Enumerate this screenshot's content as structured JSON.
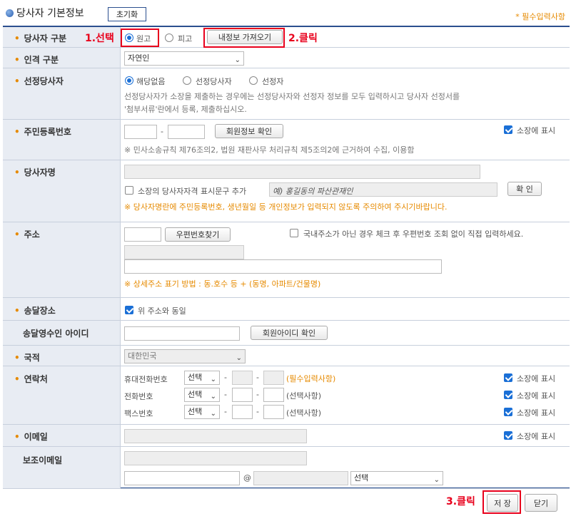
{
  "header": {
    "title": "당사자 기본정보",
    "reset_label": "초기화",
    "required_note": "* 필수입력사항"
  },
  "rows": {
    "party_type": {
      "label": "당사자 구분",
      "options": [
        "원고",
        "피고"
      ],
      "selected": "원고",
      "fetch_button": "내정보 가져오기"
    },
    "person_type": {
      "label": "인격 구분",
      "value": "자연인"
    },
    "representative": {
      "label": "선정당사자",
      "options": [
        "해당없음",
        "선정당사자",
        "선정자"
      ],
      "selected": "해당없음",
      "note1": "선정당사자가 소장을 제출하는 경우에는 선정당사자와 선정자 정보를 모두 입력하시고 당사자 선정서를",
      "note2": "'첨부서류'란에서 등록, 제출하십시오."
    },
    "resident_no": {
      "label": "주민등록번호",
      "dash": "-",
      "verify_button": "회원정보 확인",
      "display_label": "소장에 표시",
      "note": "※ 민사소송규칙 제76조의2, 법원 재판사무 처리규칙 제5조의2에 근거하여 수집, 이용함"
    },
    "name": {
      "label": "당사자명",
      "qualifier_label": "소장의 당사자자격 표시문구 추가",
      "qualifier_placeholder": "예) 홍길동의 파산관재인",
      "confirm_button": "확 인",
      "warning": "※ 당사자명란에 주민등록번호, 생년월일 등 개인정보가 입력되지 않도록 주의하여 주시기바랍니다."
    },
    "address": {
      "label": "주소",
      "postcode_button": "우편번호찾기",
      "foreign_label": "국내주소가 아닌 경우 체크 후 우편번호 조회 없이 직접 입력하세요.",
      "hint": "※ 상세주소 표기 방법 : 동.호수 등 + (동명, 아파트/건물명)"
    },
    "delivery": {
      "label": "송달장소",
      "same_label": "위 주소와 동일"
    },
    "delivery_receiver": {
      "label": "송달영수인 아이디",
      "verify_button": "회원아이디 확인"
    },
    "nationality": {
      "label": "국적",
      "value": "대한민국"
    },
    "contact": {
      "label": "연락처",
      "lines": [
        {
          "name": "휴대전화번호",
          "select": "선택",
          "note": "(필수입력사항)",
          "display": "소장에 표시"
        },
        {
          "name": "전화번호",
          "select": "선택",
          "note": "(선택사항)",
          "display": "소장에 표시"
        },
        {
          "name": "팩스번호",
          "select": "선택",
          "note": "(선택사항)",
          "display": "소장에 표시"
        }
      ],
      "dash": "-"
    },
    "email": {
      "label": "이메일",
      "display_label": "소장에 표시"
    },
    "sub_email": {
      "label": "보조이메일",
      "at": "@",
      "domain_select": "선택"
    }
  },
  "footer": {
    "save_label": "저 장",
    "close_label": "닫기"
  },
  "annotations": {
    "step1": "1.선택",
    "step2": "2.클릭",
    "step3": "3.클릭"
  },
  "colors": {
    "accent": "#2b4f8f",
    "label_bg": "#e8ecf3",
    "required": "#e68a00",
    "annotation": "#e8001c",
    "checkbox": "#1a6fd6"
  }
}
